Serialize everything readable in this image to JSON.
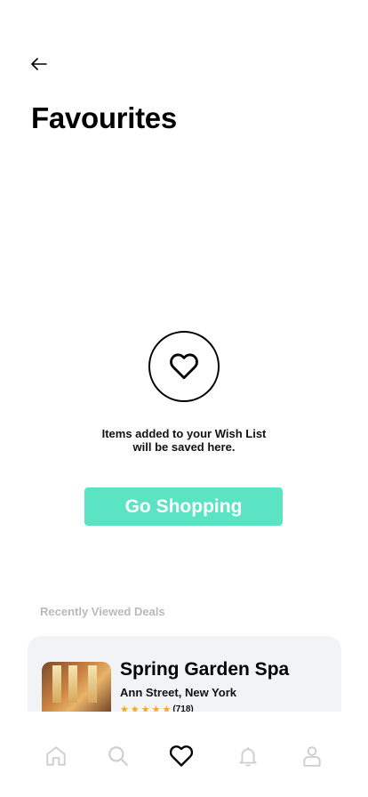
{
  "header": {
    "title": "Favourites"
  },
  "empty_state": {
    "message_line1": "Items added to your Wish List",
    "message_line2": "will be saved here.",
    "button_label": "Go Shopping",
    "icon": "heart-icon"
  },
  "recent": {
    "label": "Recently Viewed Deals",
    "deals": [
      {
        "name": "Spring Garden Spa",
        "location": "Ann Street, New York",
        "rating_stars": 5,
        "review_count": "(718)"
      }
    ]
  },
  "nav": {
    "items": [
      "home-icon",
      "search-icon",
      "heart-icon",
      "bell-icon",
      "profile-icon"
    ],
    "active": "heart-icon"
  },
  "colors": {
    "accent": "#5ae4c4",
    "star": "#f5a623",
    "card_bg": "#f2f3f7",
    "muted": "#b9b9b9"
  }
}
